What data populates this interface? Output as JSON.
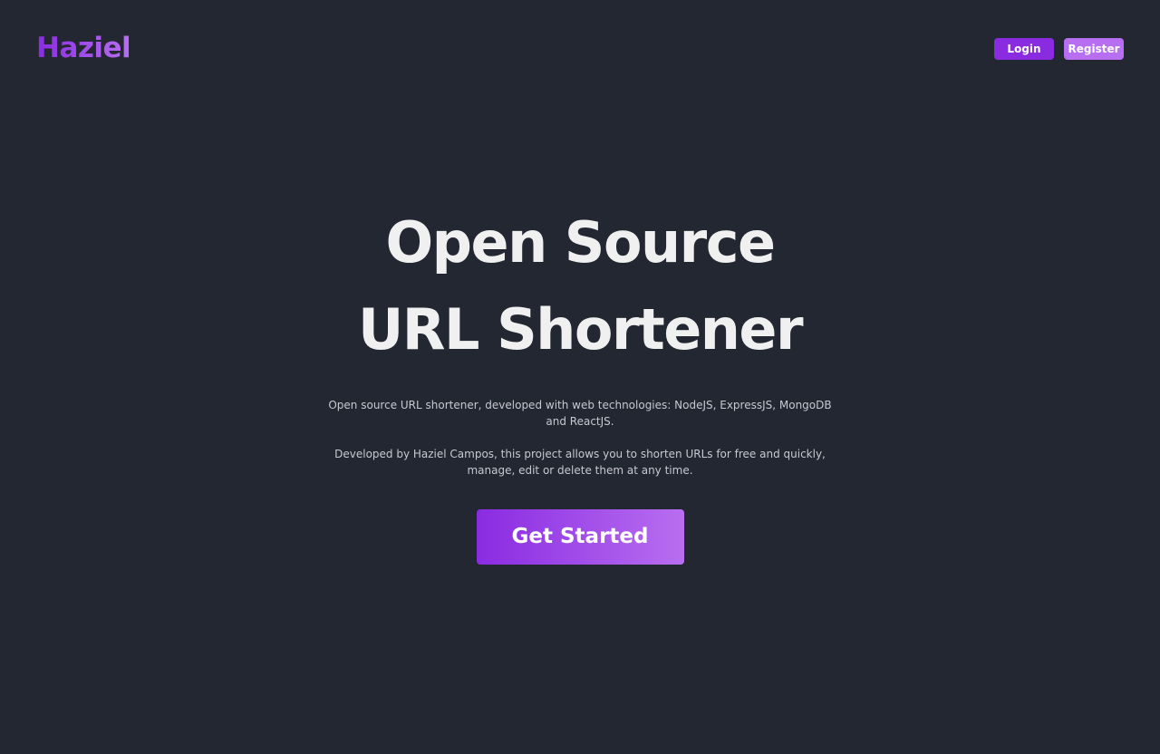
{
  "app": {
    "brand": "Haziel"
  },
  "nav": {
    "login_label": "Login",
    "register_label": "Register"
  },
  "hero": {
    "title_line_1": "Open Source",
    "title_line_2": "URL Shortener",
    "description_1": "Open source URL shortener, developed with web technologies: NodeJS, ExpressJS, MongoDB and ReactJS.",
    "description_2": "Developed by Haziel Campos, this project allows you to shorten URLs for free and quickly, manage, edit or delete them at any time.",
    "cta_label": "Get Started"
  },
  "colors": {
    "background": "#222731",
    "accent_primary": "#8a2be2",
    "accent_secondary": "#b86ef0",
    "title_text": "#f0f0f0",
    "body_text": "#c8c8d0"
  }
}
